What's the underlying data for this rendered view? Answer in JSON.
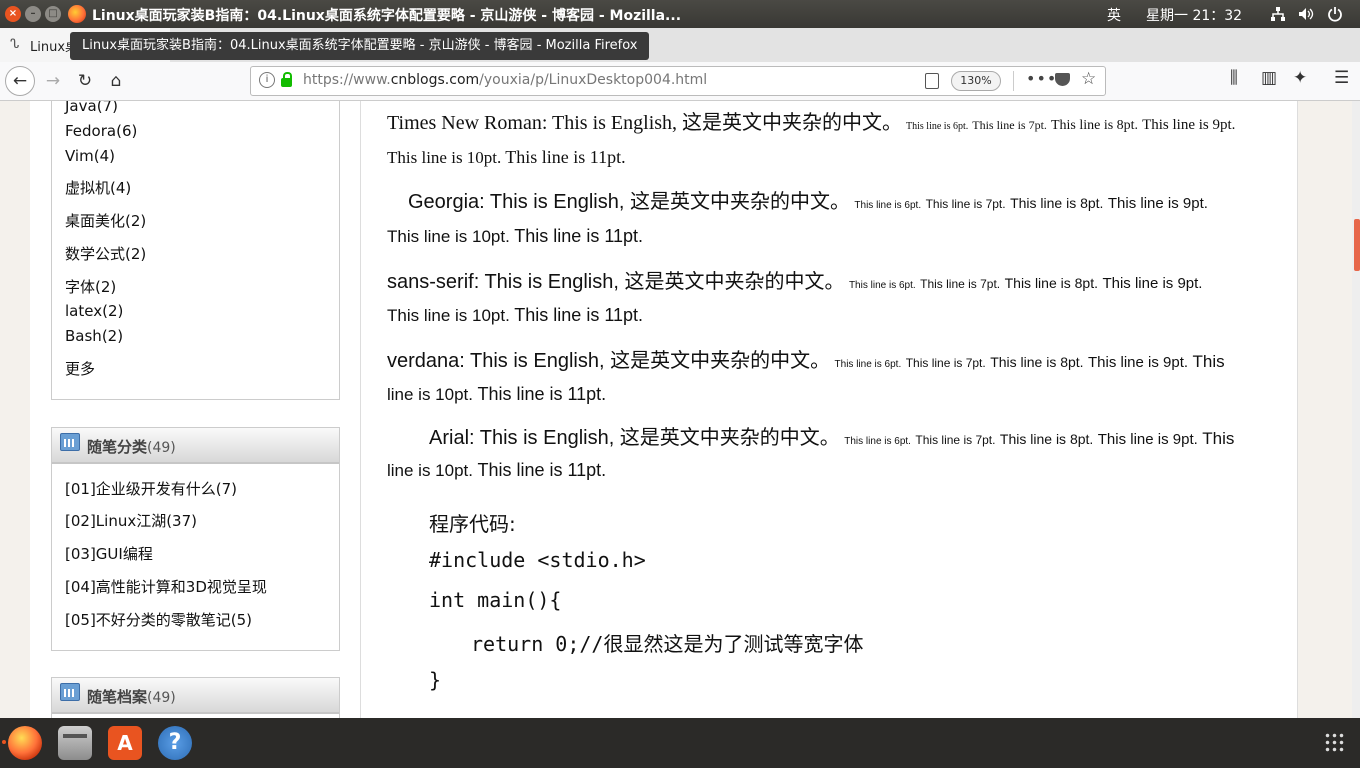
{
  "titlebar": {
    "title": "Linux桌面玩家装B指南：04.Linux桌面系统字体配置要略 - 京山游侠 - 博客园 - Mozilla...",
    "ime": "英",
    "clock": "星期一 21：32"
  },
  "tab": {
    "label": "Linux桌面玩家装B指南：",
    "tooltip": "Linux桌面玩家装B指南：04.Linux桌面系统字体配置要略 - 京山游侠 - 博客园 - Mozilla Firefox"
  },
  "nav": {
    "url_prefix": "https://www.",
    "url_domain": "cnblogs.com",
    "url_path": "/youxia/p/LinuxDesktop004.html",
    "zoom": "130%"
  },
  "sidebar": {
    "tags": [
      {
        "label": "Java",
        "count": "(7)"
      },
      {
        "label": "Fedora",
        "count": "(6)"
      },
      {
        "label": "Vim",
        "count": "(4)"
      },
      {
        "label": "虚拟机",
        "count": "(4)"
      },
      {
        "label": "桌面美化",
        "count": "(2)"
      },
      {
        "label": "数学公式",
        "count": "(2)"
      },
      {
        "label": "字体",
        "count": "(2)"
      },
      {
        "label": "latex",
        "count": "(2)"
      },
      {
        "label": "Bash",
        "count": "(2)"
      }
    ],
    "more": "更多",
    "categories_title": "随笔分类",
    "categories_count": "(49)",
    "categories": [
      "[01]企业级开发有什么(7)",
      "[02]Linux江湖(37)",
      "[03]GUI编程",
      "[04]高性能计算和3D视觉呈现",
      "[05]不好分类的零散笔记(5)"
    ],
    "archive_title": "随笔档案",
    "archive_count": "(49)"
  },
  "article": {
    "fonts": [
      {
        "lead": "Times New Roman: This is English, 这是英文中夹杂的中文。"
      },
      {
        "lead": "Georgia: This is English, 这是英文中夹杂的中文。"
      },
      {
        "lead": "sans-serif: This is English, 这是英文中夹杂的中文。"
      },
      {
        "lead": "verdana: This is English, 这是英文中夹杂的中文。"
      },
      {
        "lead": "Arial: This is English, 这是英文中夹杂的中文。"
      }
    ],
    "s6": "This line is 6pt.",
    "s7": "This line is 7pt.",
    "s8": "This line is 8pt.",
    "s9": "This line is 9pt.",
    "s9a": "This",
    "s10": "This line is 10pt.",
    "s10a": "line is 10pt.",
    "s11": "This line is 11pt.",
    "code_label": "程序代码:",
    "code": [
      "#include <stdio.h>",
      "int main(){",
      "return 0;//很显然这是为了测试等宽字体",
      "}"
    ]
  }
}
